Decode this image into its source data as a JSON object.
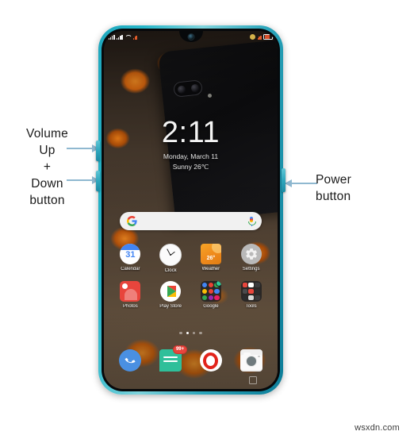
{
  "annotations": {
    "volume_label": "Volume\nUp\n+\nDown\nbutton",
    "power_label": "Power\nbutton",
    "arrow_color": "#8fb8d0"
  },
  "watermark": "wsxdn.com",
  "phone": {
    "frame_color": "#27b6c9",
    "hardware_buttons": [
      {
        "name": "volume-up-button",
        "label": "Volume Up"
      },
      {
        "name": "volume-down-button",
        "label": "Volume Down"
      },
      {
        "name": "power-button",
        "label": "Power"
      }
    ],
    "statusbar": {
      "left_icons": [
        "signal-bars-icon",
        "mobile-data-icon",
        "wifi-icon",
        "network-icon"
      ],
      "right_icons": [
        "silent-mode-icon",
        "alarm-icon",
        "battery-icon"
      ]
    },
    "clock_widget": {
      "time": "2:11",
      "date": "Monday, March 11",
      "weather": "Sunny 26℃"
    },
    "search": {
      "placeholder": "",
      "value": "",
      "left_icon": "google-g-icon",
      "right_icon": "microphone-icon"
    },
    "app_rows": [
      [
        {
          "label": "Calendar",
          "icon": "calendar-icon",
          "day": "31"
        },
        {
          "label": "Clock",
          "icon": "clock-icon"
        },
        {
          "label": "Weather",
          "icon": "weather-icon",
          "temp": "26°"
        },
        {
          "label": "Settings",
          "icon": "gear-icon"
        }
      ],
      [
        {
          "label": "Photos",
          "icon": "photos-icon"
        },
        {
          "label": "Play Store",
          "icon": "play-store-icon"
        },
        {
          "label": "Google",
          "icon": "folder-icon"
        },
        {
          "label": "Tools",
          "icon": "folder-icon"
        }
      ]
    ],
    "page_dots": {
      "count": 4,
      "active_index": 1
    },
    "dock": [
      {
        "label": "Phone",
        "icon": "phone-icon",
        "badge": ""
      },
      {
        "label": "Messages",
        "icon": "messages-icon",
        "badge": "99+"
      },
      {
        "label": "Opera",
        "icon": "opera-icon",
        "badge": ""
      },
      {
        "label": "Camera",
        "icon": "camera-icon",
        "badge": ""
      }
    ],
    "nav_indicator": "recents-square-icon"
  }
}
